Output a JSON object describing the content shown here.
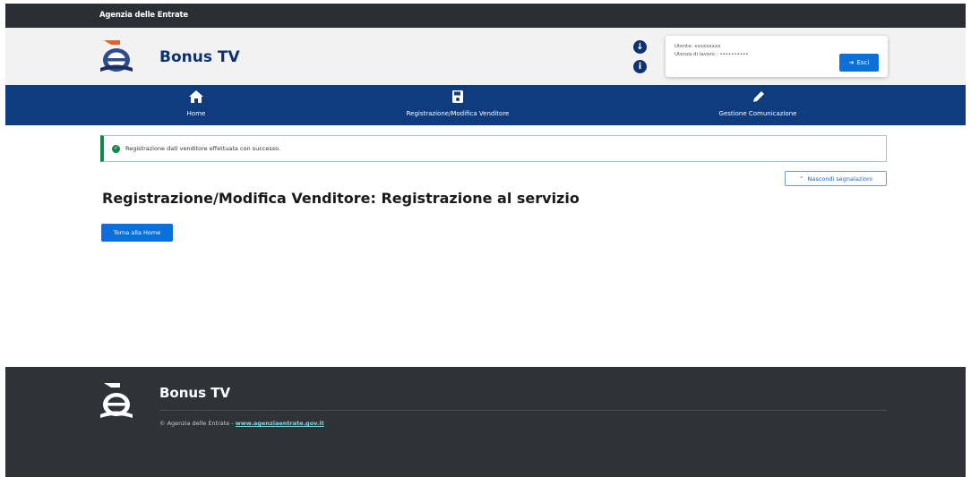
{
  "topbar": {
    "org_name": "Agenzia delle Entrate"
  },
  "header": {
    "app_title": "Bonus TV",
    "user": {
      "label_user": "Utente: xxxxxxxxx",
      "label_workplace": "Utenza di lavoro : ••••••••••",
      "exit_label": "Esci"
    },
    "icons": [
      "download-icon",
      "info-icon"
    ]
  },
  "nav": {
    "items": [
      {
        "label": "Home",
        "icon": "home-icon"
      },
      {
        "label": "Registrazione/Modifica Venditore",
        "icon": "save-icon"
      },
      {
        "label": "Gestione Comunicazione",
        "icon": "pencil-icon"
      }
    ]
  },
  "alert": {
    "message": "Registrazione dati venditore effettuata con successo."
  },
  "toggle_alerts_label": "Nascondi segnalazioni",
  "page_title": "Registrazione/Modifica Venditore: Registrazione al servizio",
  "back_home_label": "Torna alla Home",
  "footer": {
    "title": "Bonus TV",
    "copyright": "© Agenzia delle Entrate -",
    "link": "www.agenziaentrate.gov.it"
  },
  "colors": {
    "topbar": "#2b2f35",
    "navbar": "#0e3c7e",
    "primary_button": "#0d6fd8",
    "success": "#0f8a4a",
    "footer": "#2f3338"
  }
}
